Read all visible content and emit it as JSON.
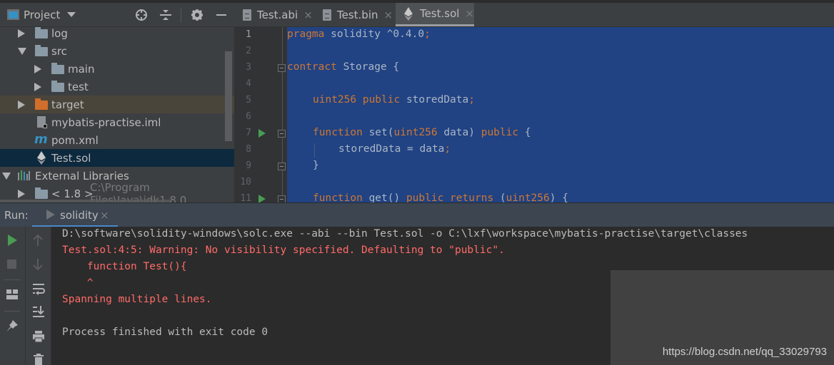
{
  "project_panel": {
    "title": "Project",
    "header_icons": [
      "locate-icon",
      "collapse-all-icon",
      "gear-icon",
      "minimize-icon"
    ],
    "tree": [
      {
        "label": "log",
        "type": "folder",
        "expanded": false
      },
      {
        "label": "src",
        "type": "folder",
        "expanded": true
      },
      {
        "label": "main",
        "type": "folder",
        "expanded": false
      },
      {
        "label": "test",
        "type": "folder",
        "expanded": false
      },
      {
        "label": "target",
        "type": "folder-excluded",
        "expanded": false
      },
      {
        "label": "mybatis-practise.iml",
        "type": "iml-file"
      },
      {
        "label": "pom.xml",
        "type": "maven-file"
      },
      {
        "label": "Test.sol",
        "type": "solidity-file",
        "selected": true
      },
      {
        "label": "External Libraries",
        "type": "libraries",
        "expanded": true
      },
      {
        "label": "< 1.8 >",
        "type": "jdk",
        "path": "C:\\Program Files\\Java\\jdk1.8.0",
        "expanded": false
      }
    ]
  },
  "editor": {
    "tabs": [
      {
        "label": "Test.abi",
        "icon": "text-file-icon",
        "close": "×"
      },
      {
        "label": "Test.bin",
        "icon": "text-file-icon",
        "close": "×"
      },
      {
        "label": "Test.sol",
        "icon": "ethereum-icon",
        "close": "×",
        "active": true
      }
    ],
    "line_numbers": [
      "1",
      "2",
      "3",
      "4",
      "5",
      "6",
      "7",
      "8",
      "9",
      "10",
      "11"
    ],
    "code": {
      "l1_kw": "pragma",
      "l1_rest": " solidity ^0.4.0",
      "l1_semi": ";",
      "l3_kw": "contract",
      "l3_rest": " Storage {",
      "l5_type": "uint256",
      "l5_kw": " public",
      "l5_rest": " storedData",
      "l5_semi": ";",
      "l7_kw": "function",
      "l7_a": " set(",
      "l7_type": "uint256",
      "l7_b": " data) ",
      "l7_kw2": "public",
      "l7_c": " {",
      "l8_a": "storedData = data",
      "l8_semi": ";",
      "l9": "}",
      "l11_kw": "function",
      "l11_a": " get() ",
      "l11_kw2": "public returns",
      "l11_b": " (",
      "l11_type": "uint256",
      "l11_c": ") {"
    }
  },
  "run_panel": {
    "label": "Run:",
    "tab_label": "solidity",
    "tab_close": "×",
    "console": [
      {
        "text": "D:\\software\\solidity-windows\\solc.exe --abi --bin Test.sol -o C:\\lxf\\workspace\\mybatis-practise\\target\\classes",
        "kind": "normal"
      },
      {
        "text": "Test.sol:4:5: Warning: No visibility specified. Defaulting to \"public\".",
        "kind": "error"
      },
      {
        "text": "    function Test(){",
        "kind": "error"
      },
      {
        "text": "    ^",
        "kind": "error"
      },
      {
        "text": "Spanning multiple lines.",
        "kind": "error"
      },
      {
        "text": "",
        "kind": "normal"
      },
      {
        "text": "Process finished with exit code 0",
        "kind": "normal"
      }
    ]
  },
  "watermark": "https://blog.csdn.net/qq_33029793",
  "colors": {
    "selection": "#214283",
    "keyword": "#cc7832",
    "code_text": "#a9b7c6",
    "console_error": "#ff6b68",
    "run_green": "#499c54",
    "tab_underline": "#4a88c7"
  }
}
